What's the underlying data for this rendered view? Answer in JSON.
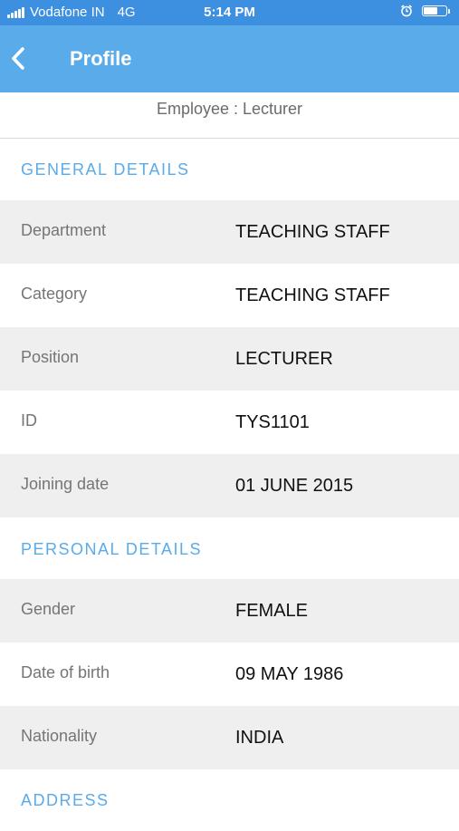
{
  "status_bar": {
    "carrier": "Vodafone IN",
    "network": "4G",
    "time": "5:14 PM",
    "battery_level": 0.7
  },
  "nav": {
    "title": "Profile"
  },
  "employee_line": "Employee : Lecturer",
  "sections": {
    "general": {
      "title": "GENERAL DETAILS",
      "rows": [
        {
          "label": "Department",
          "value": "TEACHING STAFF"
        },
        {
          "label": "Category",
          "value": "TEACHING STAFF"
        },
        {
          "label": "Position",
          "value": "LECTURER"
        },
        {
          "label": "ID",
          "value": "TYS1101"
        },
        {
          "label": "Joining date",
          "value": "01 JUNE 2015"
        }
      ]
    },
    "personal": {
      "title": "PERSONAL DETAILS",
      "rows": [
        {
          "label": "Gender",
          "value": "FEMALE"
        },
        {
          "label": "Date of birth",
          "value": "09 MAY 1986"
        },
        {
          "label": "Nationality",
          "value": "INDIA"
        }
      ]
    },
    "address": {
      "title": "ADDRESS"
    }
  },
  "colors": {
    "status_bar": "#3d8fe0",
    "nav_bar": "#5aabea",
    "section_title": "#5aabea",
    "row_shade": "#efefef"
  }
}
